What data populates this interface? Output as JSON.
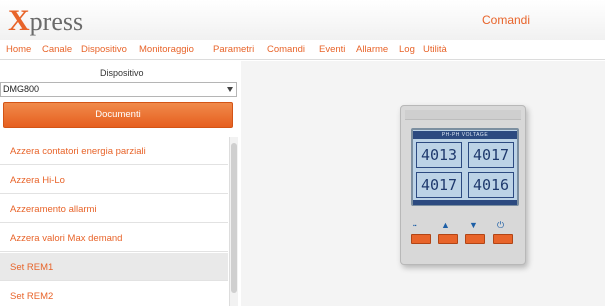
{
  "app": {
    "logo_x": "X",
    "logo_rest": "press",
    "section_title": "Comandi"
  },
  "menu": [
    "Home",
    "Canale",
    "Dispositivo",
    "Monitoraggio",
    "Parametri",
    "Comandi",
    "Eventi",
    "Allarme",
    "Log",
    "Utilità"
  ],
  "sidebar": {
    "device_label": "Dispositivo",
    "device_value": "DMG800",
    "documents_button": "Documenti",
    "commands": [
      "Azzera contatori energia parziali",
      "Azzera Hi-Lo",
      "Azzeramento allarmi",
      "Azzera valori Max demand",
      "Set REM1",
      "Set REM2"
    ],
    "selected_index": 4
  },
  "device_display": {
    "header": "PH-PH VOLTAGE",
    "values": [
      "4013",
      "4017",
      "4017",
      "4016"
    ],
    "keys": [
      "menu-icon",
      "up-arrow-icon",
      "down-arrow-icon",
      "power-icon"
    ]
  },
  "colors": {
    "accent": "#e8642a",
    "lcd_bg": "#bcd3e6",
    "lcd_text": "#1f3a6e"
  }
}
